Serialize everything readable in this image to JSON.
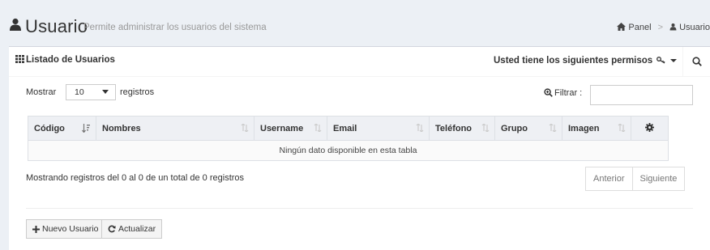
{
  "header": {
    "title": "Usuario",
    "subtitle": "Permite administrar los usuarios del sistema",
    "breadcrumb": [
      {
        "label": "Panel",
        "icon": "home-icon"
      },
      {
        "label": "Usuario",
        "icon": "user-icon"
      }
    ]
  },
  "box": {
    "title": "Listado de Usuarios",
    "permissions_label": "Usted tiene los siguientes permisos",
    "search_tab_icon": "search-icon"
  },
  "table_controls": {
    "show_label": "Mostrar",
    "page_length": "10",
    "records_label": "registros",
    "filter_label": "Filtrar :",
    "filter_value": ""
  },
  "table": {
    "columns": [
      "Código",
      "Nombres",
      "Username",
      "Email",
      "Teléfono",
      "Grupo",
      "Imagen"
    ],
    "settings_icon": "gear-icon",
    "empty_message": "Ningún dato disponible en esta tabla"
  },
  "footer": {
    "info": "Mostrando registros del 0 al 0 de un total de 0 registros",
    "prev_label": "Anterior",
    "next_label": "Siguiente"
  },
  "actions": {
    "new_label": "Nuevo Usuario",
    "refresh_label": "Actualizar"
  },
  "colors": {
    "background": "#ecf0f5",
    "table_header": "#eef0f4",
    "box_border": "#d2d6de"
  }
}
